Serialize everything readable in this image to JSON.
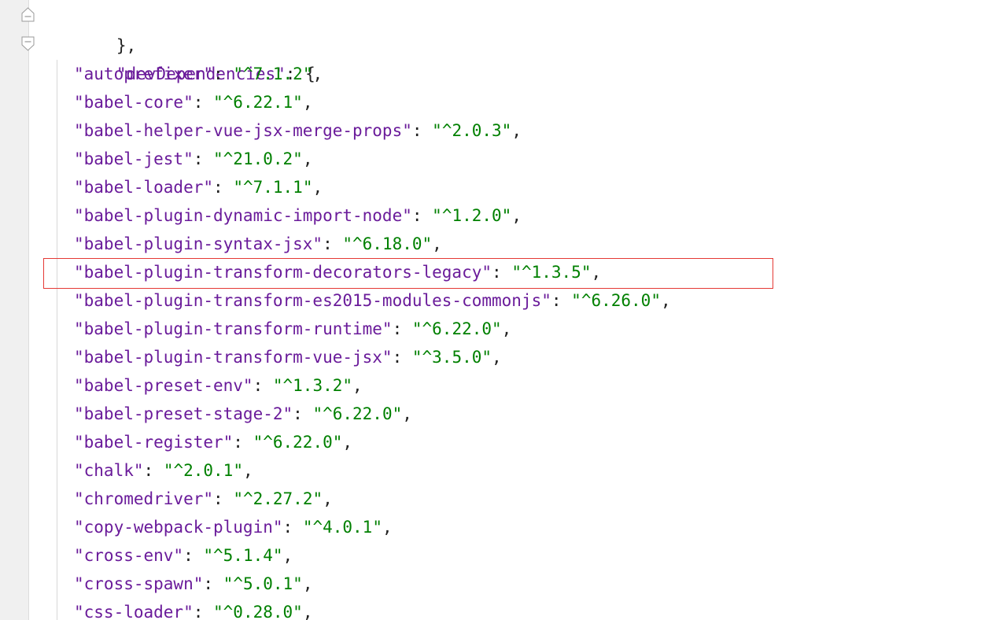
{
  "editor": {
    "closing_brace": "},",
    "section": {
      "key": "\"devDependencies\"",
      "open": ": {"
    },
    "dependencies": [
      {
        "name": "\"autoprefixer\"",
        "version": "\"^7.1.2\""
      },
      {
        "name": "\"babel-core\"",
        "version": "\"^6.22.1\""
      },
      {
        "name": "\"babel-helper-vue-jsx-merge-props\"",
        "version": "\"^2.0.3\""
      },
      {
        "name": "\"babel-jest\"",
        "version": "\"^21.0.2\""
      },
      {
        "name": "\"babel-loader\"",
        "version": "\"^7.1.1\""
      },
      {
        "name": "\"babel-plugin-dynamic-import-node\"",
        "version": "\"^1.2.0\""
      },
      {
        "name": "\"babel-plugin-syntax-jsx\"",
        "version": "\"^6.18.0\""
      },
      {
        "name": "\"babel-plugin-transform-decorators-legacy\"",
        "version": "\"^1.3.5\""
      },
      {
        "name": "\"babel-plugin-transform-es2015-modules-commonjs\"",
        "version": "\"^6.26.0\""
      },
      {
        "name": "\"babel-plugin-transform-runtime\"",
        "version": "\"^6.22.0\""
      },
      {
        "name": "\"babel-plugin-transform-vue-jsx\"",
        "version": "\"^3.5.0\""
      },
      {
        "name": "\"babel-preset-env\"",
        "version": "\"^1.3.2\""
      },
      {
        "name": "\"babel-preset-stage-2\"",
        "version": "\"^6.22.0\""
      },
      {
        "name": "\"babel-register\"",
        "version": "\"^6.22.0\""
      },
      {
        "name": "\"chalk\"",
        "version": "\"^2.0.1\""
      },
      {
        "name": "\"chromedriver\"",
        "version": "\"^2.27.2\""
      },
      {
        "name": "\"copy-webpack-plugin\"",
        "version": "\"^4.0.1\""
      },
      {
        "name": "\"cross-env\"",
        "version": "\"^5.1.4\""
      },
      {
        "name": "\"cross-spawn\"",
        "version": "\"^5.0.1\""
      },
      {
        "name": "\"css-loader\"",
        "version": "\"^0.28.0\""
      }
    ],
    "separator": ": ",
    "comma": ",",
    "highlighted_index": 7
  },
  "colors": {
    "key": "#6a1b9a",
    "string": "#008000",
    "highlight_border": "#e53935",
    "gutter": "#f0f0f0"
  },
  "icons": [
    "fold-end-icon",
    "fold-start-icon"
  ]
}
